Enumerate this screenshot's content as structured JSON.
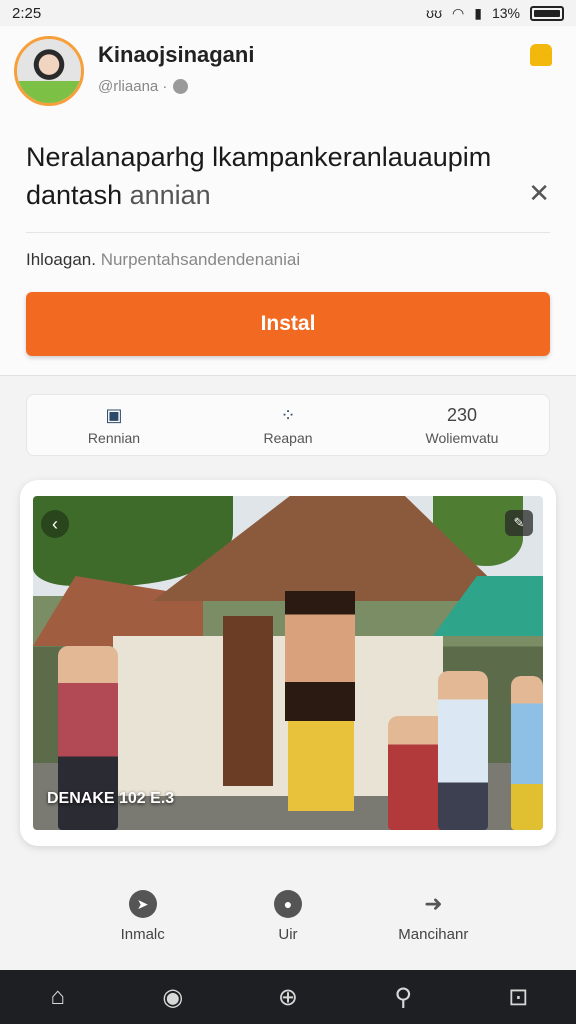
{
  "status": {
    "time": "2:25",
    "icons": "ʊʊ",
    "battery_pct": "13%"
  },
  "app": {
    "name": "Kinaojsinagani",
    "subtitle": "@rliaana ·"
  },
  "headline": {
    "main": "Neralanaparhg lkampankeranlauaupim dantash",
    "tail": "annian"
  },
  "meta": {
    "lead": "Ihloagan.",
    "rest": "Nurpentahsandendenaniai"
  },
  "install": {
    "label": "Instal"
  },
  "stats": [
    {
      "icon": "▣",
      "label": "Rennian"
    },
    {
      "icon": "⁘",
      "label": "Reapan"
    },
    {
      "icon": "",
      "num": "230",
      "label": "Woliemvatu"
    }
  ],
  "photo": {
    "caption": "DENAKE 102 E.3",
    "back": "‹",
    "corner": "✎"
  },
  "actions": [
    {
      "icon": "➤",
      "label": "Inmalc"
    },
    {
      "icon": "●",
      "label": "Uir"
    },
    {
      "icon": "➜",
      "label": "Mancihanr"
    }
  ],
  "nav": [
    "⌂",
    "◉",
    "⊕",
    "⚲",
    "⊡"
  ],
  "colors": {
    "accent": "#f26a21",
    "navbar": "#1e1f22"
  }
}
